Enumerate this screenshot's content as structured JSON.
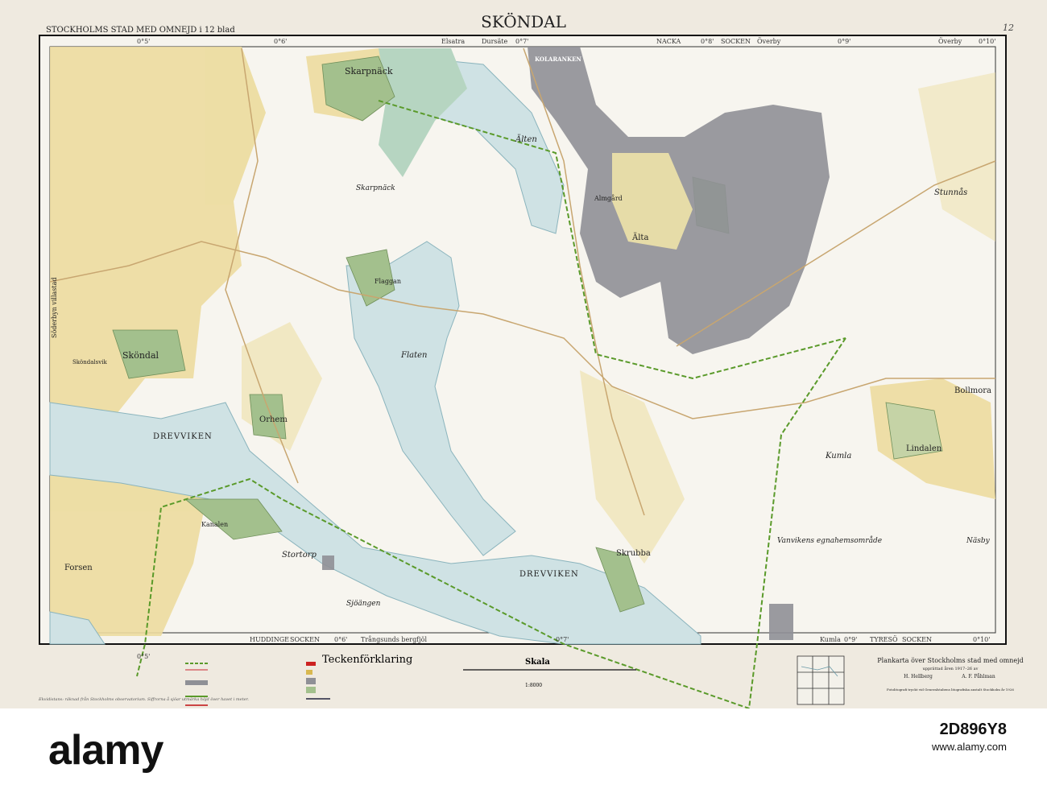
{
  "header": {
    "title": "SKÖNDAL",
    "series": "STOCKHOLMS STAD MED OMNEJD i 12 blad",
    "sheet_no": "12"
  },
  "frame_top": [
    "0°5'",
    "0°6'",
    "Elsatra",
    "Dursäte",
    "0°7'",
    "NACKA",
    "0°8'",
    "SOCKEN",
    "Överby",
    "0°9'",
    "Överby",
    "0°10'"
  ],
  "frame_bottom": [
    "0°5'",
    "HUDDINGE",
    "SOCKEN",
    "0°6'",
    "Trångsunds bergfjöl",
    "0°7'",
    "Kumla",
    "0°9'",
    "TYRESÖ",
    "SOCKEN",
    "0°10'"
  ],
  "places": {
    "skarpnack_village": "Skarpnäck",
    "skarpnack_area": "Skarpnäck",
    "kolaranken": "KOLARANKEN",
    "alten": "Älten",
    "almgard": "Almgård",
    "alta": "Älta",
    "stunnas": "Stunnås",
    "flaten": "Flaten",
    "flaggan": "Flaggan",
    "skondal": "Sköndal",
    "skondalsvik": "Sköndalsvik",
    "orhem": "Orhem",
    "drevviken_w": "DREVVIKEN",
    "drevviken_s": "DREVVIKEN",
    "stortorp": "Stortorp",
    "sjoangen": "Sjöängen",
    "forsen": "Forsen",
    "kanalen": "Kanalen",
    "skrubba": "Skrubba",
    "kumla": "Kumla",
    "lindalen": "Lindalen",
    "bollmora": "Bollmora",
    "nasby": "Näsby",
    "vanviken": "Vanvikens egnahemsområde",
    "villastad": "Söderbyn villastad"
  },
  "legend": {
    "title": "Teckenförklaring",
    "note": "Ekvidistans: räknad från Stockholms observatorium. Siffrorna å sjöar utmärka höjd över havet i meter."
  },
  "scale": {
    "title": "Skala",
    "ratio": "1:8000"
  },
  "imprint": {
    "title": "Plankarta över Stockholms stad med omnejd",
    "subtitle": "upprättad åren 1917–26 av",
    "author1": "H. Hellberg",
    "author2": "A. F. Påhlman",
    "footer": "Fotolitografi tryckt vid Generalstabens litografiska anstalt Stockholm år 1926"
  },
  "watermark": {
    "brand": "alamy",
    "image_id": "2D896Y8",
    "site": "www.alamy.com"
  },
  "colors": {
    "paper": "#efeae0",
    "map": "#f6f4ee",
    "water": "#cfe2e4",
    "field": "#ecdc9e",
    "park": "#a3c08d",
    "urban": "#8f9096",
    "boundary": "#5a9a2a"
  }
}
